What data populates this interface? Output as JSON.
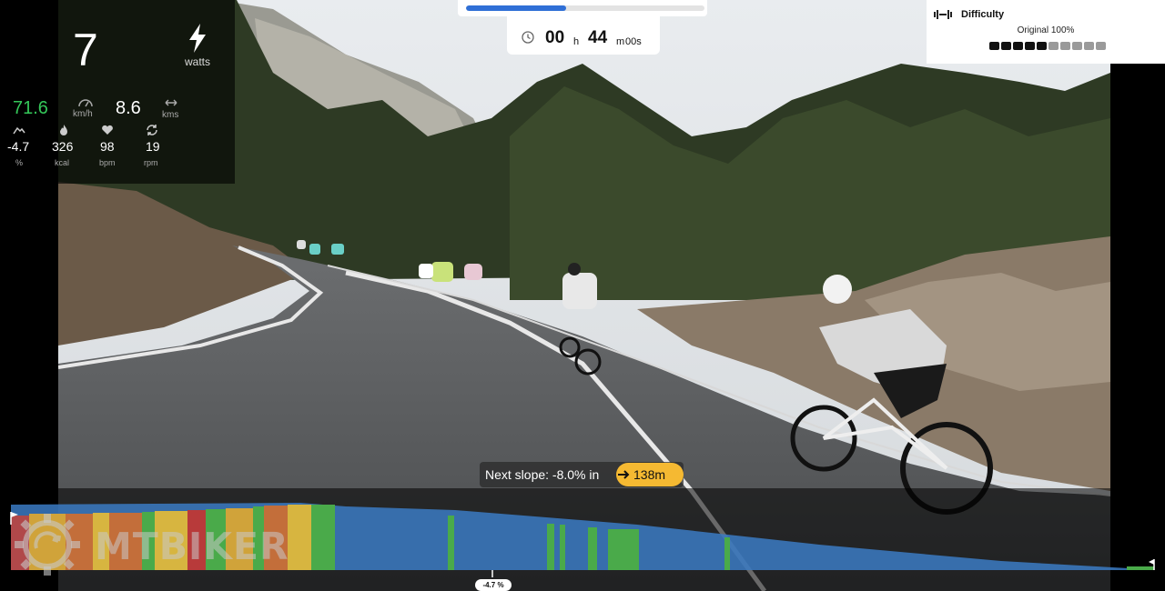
{
  "stats": {
    "power": {
      "value": "7",
      "unit": "watts",
      "icon": "lightning-icon"
    },
    "speed": {
      "value": "71.6",
      "unit": "km/h",
      "icon": "speedometer-icon",
      "color": "#34c759"
    },
    "distance": {
      "value": "8.6",
      "unit": "kms",
      "icon": "distance-arrows-icon"
    },
    "slope": {
      "value": "-4.7",
      "unit": "%",
      "icon": "mountain-icon"
    },
    "calories": {
      "value": "326",
      "unit": "kcal",
      "icon": "flame-icon"
    },
    "heart_rate": {
      "value": "98",
      "unit": "bpm",
      "icon": "heart-icon"
    },
    "cadence": {
      "value": "19",
      "unit": "rpm",
      "icon": "cadence-icon"
    }
  },
  "progress": {
    "fraction": 0.42,
    "color": "#2f6fd6"
  },
  "timer": {
    "icon": "clock-icon",
    "hours": "00",
    "hours_unit": "h",
    "minutes": "44",
    "minutes_unit": "m",
    "seconds": "00s"
  },
  "difficulty": {
    "icon": "difficulty-icon",
    "title": "Difficulty",
    "value": "Original 100%",
    "levels_total": 10,
    "levels_active": 5
  },
  "next_slope": {
    "label": "Next slope: -8.0% in",
    "distance": "138m",
    "pill_color": "#f5b932"
  },
  "profile": {
    "current_slope": "-4.7 %",
    "start_flag_icon": "start-flag-icon",
    "finish_flag_icon": "finish-flag-icon"
  },
  "watermark": {
    "text": "MTBIKER",
    "icon": "gear-logo-icon"
  }
}
